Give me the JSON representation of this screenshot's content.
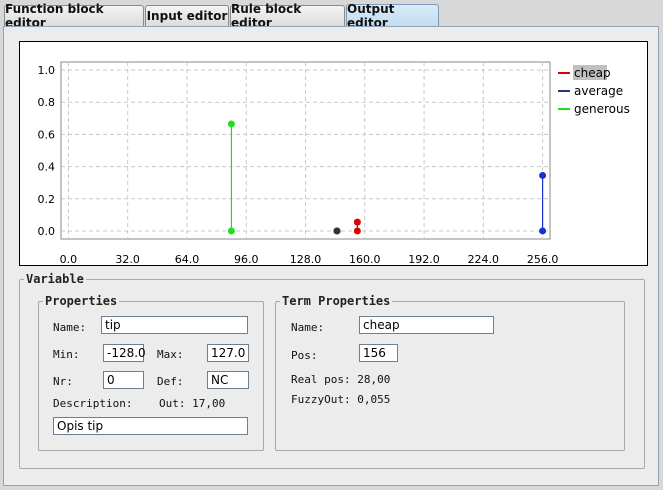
{
  "tabs": [
    {
      "label": "Function block editor"
    },
    {
      "label": "Input editor"
    },
    {
      "label": "Rule block editor"
    },
    {
      "label": "Output editor"
    }
  ],
  "chart_data": {
    "type": "scatter",
    "x_ticks": [
      "0.0",
      "32.0",
      "64.0",
      "96.0",
      "128.0",
      "160.0",
      "192.0",
      "224.0",
      "256.0"
    ],
    "y_ticks": [
      "0.0",
      "0.2",
      "0.4",
      "0.6",
      "0.8",
      "1.0"
    ],
    "xlim": [
      -4,
      260
    ],
    "ylim": [
      -0.05,
      1.05
    ],
    "grid": true,
    "legend_position": "right",
    "series": [
      {
        "name": "cheap",
        "color": "#dd0000",
        "points": [
          [
            156,
            0.0
          ],
          [
            156,
            0.055
          ]
        ]
      },
      {
        "name": "average",
        "color": "#223388",
        "points": [
          [
            145,
            0.0
          ]
        ]
      },
      {
        "name": "generous",
        "color": "#22dd22",
        "points": [
          [
            88,
            0.0
          ],
          [
            88,
            0.665
          ]
        ]
      },
      {
        "name": "",
        "color": "#1a2fd0",
        "points": [
          [
            256,
            0.0
          ],
          [
            256,
            0.345
          ]
        ]
      }
    ],
    "extra_points": [
      {
        "x": 145,
        "y": 0.0,
        "color": "#333333"
      }
    ]
  },
  "variable": {
    "legend": "Variable",
    "properties": {
      "legend": "Properties",
      "name_label": "Name:",
      "name_value": "tip",
      "min_label": "Min:",
      "min_value": "-128.0",
      "max_label": "Max:",
      "max_value": "127.0",
      "nr_label": "Nr:",
      "nr_value": "0",
      "def_label": "Def:",
      "def_value": "NC",
      "description_label": "Description:",
      "out_text": "Out: 17,00",
      "description_value": "Opis tip"
    },
    "term": {
      "legend": "Term Properties",
      "name_label": "Name:",
      "name_value": "cheap",
      "pos_label": "Pos:",
      "pos_value": "156",
      "realpos_text": "Real pos: 28,00",
      "fuzzyout_text": "FuzzyOut: 0,055"
    }
  }
}
